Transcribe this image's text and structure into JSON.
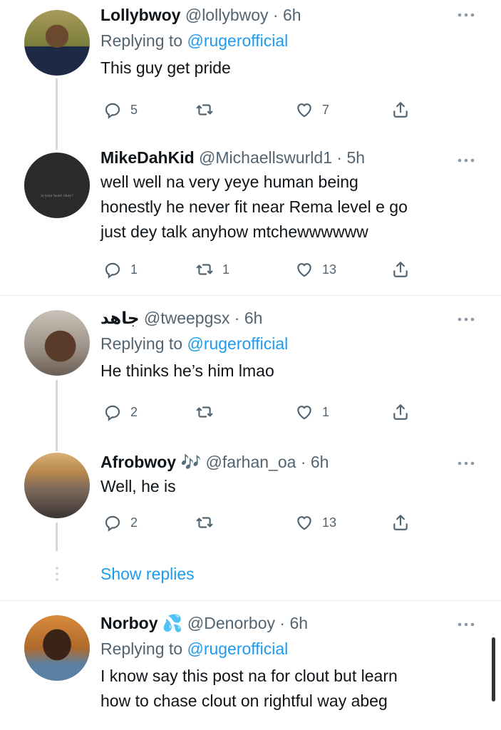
{
  "tweets": [
    {
      "name": "Lollybwoy",
      "handle": "@lollybwoy",
      "time": "6h",
      "replying_label": "Replying to",
      "replying_to": "@rugerofficial",
      "text": [
        "This guy get pride"
      ],
      "replies": "5",
      "retweets": "",
      "likes": "7"
    },
    {
      "name": "MikeDahKid",
      "handle": "@Michaellswurld1",
      "time": "5h",
      "text": [
        "well well na very yeye human being",
        "honestly he never fit near Rema level e go",
        "just dey talk anyhow mtchewwwwww"
      ],
      "replies": "1",
      "retweets": "1",
      "likes": "13",
      "avatar_text": "is your heart okay?"
    },
    {
      "name": "جاهد",
      "handle": "@tweepgsx",
      "time": "6h",
      "replying_label": "Replying to",
      "replying_to": "@rugerofficial",
      "text": [
        "He thinks he’s him lmao"
      ],
      "replies": "2",
      "retweets": "",
      "likes": "1"
    },
    {
      "name": "Afrobwoy",
      "name_emoji": "🎶",
      "handle": "@farhan_oa",
      "time": "6h",
      "text": [
        "Well, he is"
      ],
      "replies": "2",
      "retweets": "",
      "likes": "13"
    },
    {
      "name": "Norboy",
      "name_emoji": "💦",
      "handle": "@Denorboy",
      "time": "6h",
      "replying_label": "Replying to",
      "replying_to": "@rugerofficial",
      "text": [
        "I know say this post na for clout but learn",
        "how to chase clout on rightful way abeg"
      ]
    }
  ],
  "show_replies": "Show replies",
  "colors": {
    "accent": "#1d9bf0",
    "secondary": "#536471",
    "line": "#cfd9de"
  }
}
